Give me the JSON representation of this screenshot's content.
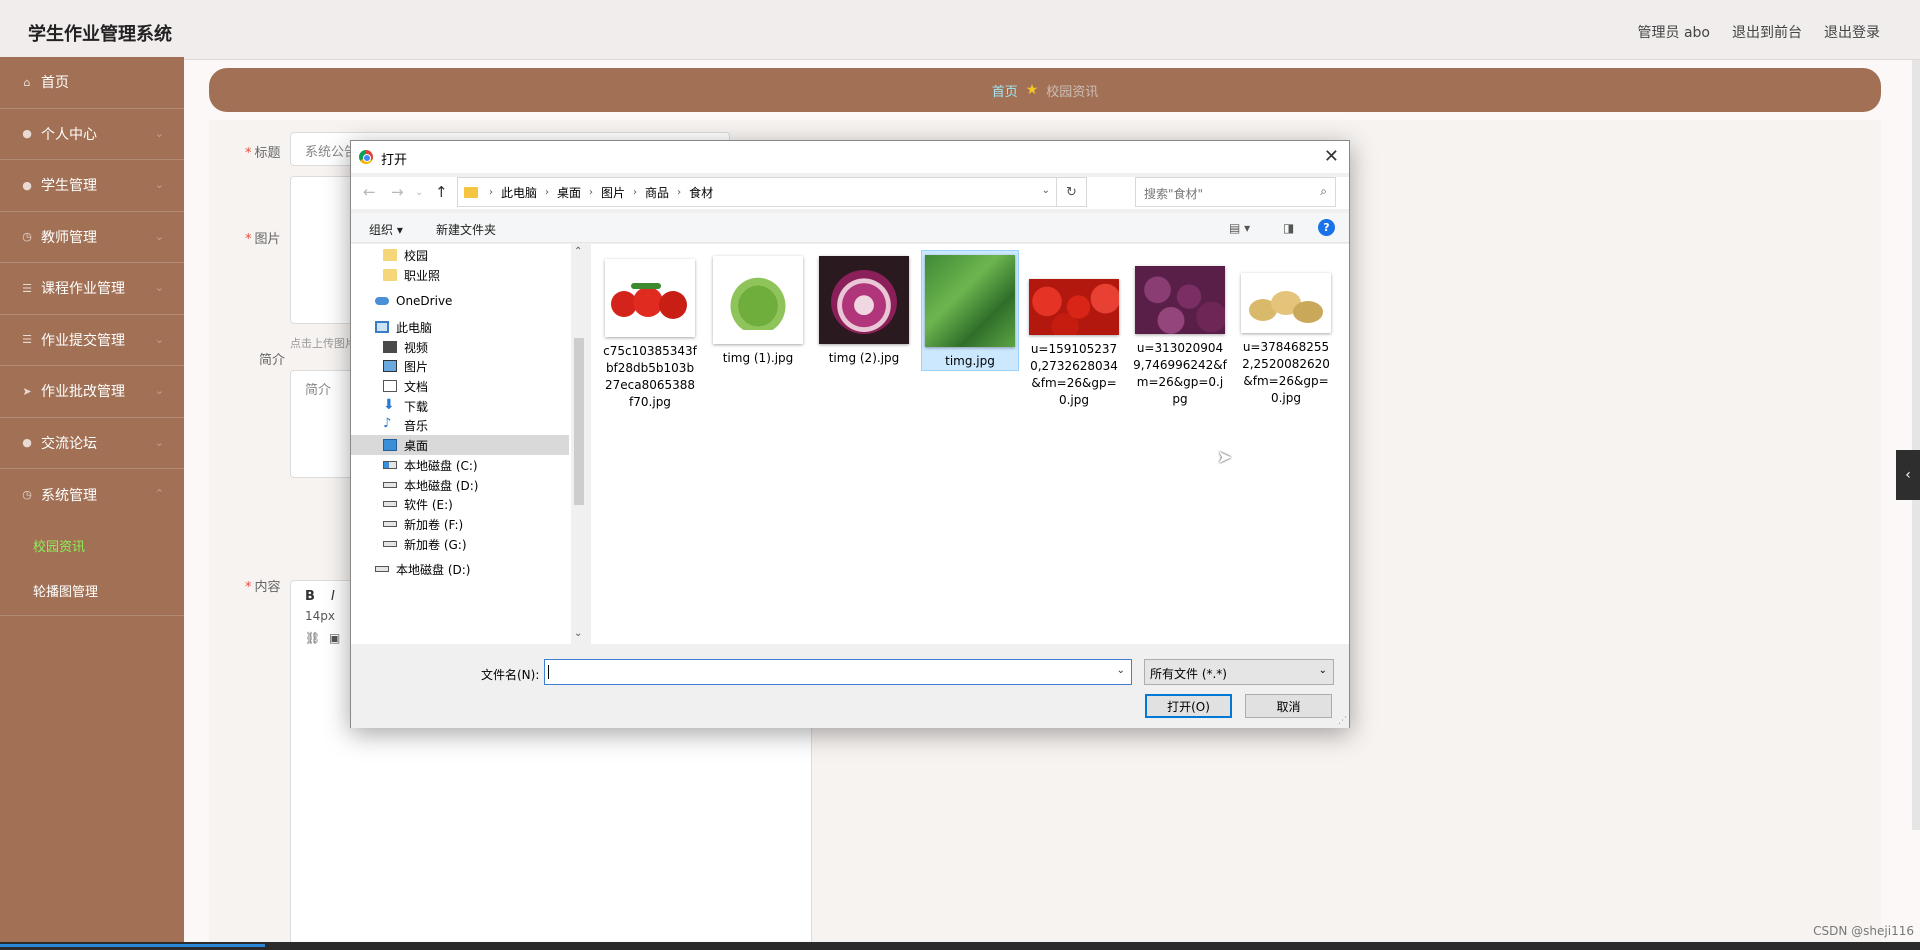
{
  "header": {
    "brand": "学生作业管理系统",
    "user": "管理员 abo",
    "to_front": "退出到前台",
    "logout": "退出登录"
  },
  "sidebar": {
    "items": [
      {
        "label": "首页",
        "icon": "home-icon"
      },
      {
        "label": "个人中心",
        "icon": "user-icon"
      },
      {
        "label": "学生管理",
        "icon": "user-icon"
      },
      {
        "label": "教师管理",
        "icon": "clock-icon"
      },
      {
        "label": "课程作业管理",
        "icon": "list-icon"
      },
      {
        "label": "作业提交管理",
        "icon": "list-icon"
      },
      {
        "label": "作业批改管理",
        "icon": "send-icon"
      },
      {
        "label": "交流论坛",
        "icon": "user-icon"
      },
      {
        "label": "系统管理",
        "icon": "clock-icon"
      }
    ],
    "submenu": [
      {
        "label": "校园资讯",
        "active": true
      },
      {
        "label": "轮播图管理",
        "active": false
      }
    ]
  },
  "breadcrumb": {
    "home": "首页",
    "current": "校园资讯"
  },
  "form": {
    "title_label": "标题",
    "title_value": "系统公告",
    "image_label": "图片",
    "upload_hint": "点击上传图片",
    "intro_label": "简介",
    "intro_placeholder": "简介",
    "content_label": "内容",
    "toolbar_bold": "B",
    "toolbar_italic": "I",
    "font_size": "14px"
  },
  "dialog": {
    "title": "打开",
    "path": [
      "此电脑",
      "桌面",
      "图片",
      "商品",
      "食材"
    ],
    "search_placeholder": "搜索\"食材\"",
    "organize": "组织 ▾",
    "new_folder": "新建文件夹",
    "help": "?",
    "nav_items": [
      {
        "label": "校园",
        "icon": "folder-icon"
      },
      {
        "label": "职业照",
        "icon": "folder-icon"
      },
      {
        "label": "OneDrive",
        "icon": "cloud-icon"
      },
      {
        "label": "此电脑",
        "icon": "computer-icon"
      },
      {
        "label": "视频",
        "icon": "video-icon"
      },
      {
        "label": "图片",
        "icon": "picture-icon"
      },
      {
        "label": "文档",
        "icon": "document-icon"
      },
      {
        "label": "下载",
        "icon": "download-icon"
      },
      {
        "label": "音乐",
        "icon": "music-icon"
      },
      {
        "label": "桌面",
        "icon": "desktop-icon"
      },
      {
        "label": "本地磁盘 (C:)",
        "icon": "drive-icon"
      },
      {
        "label": "本地磁盘 (D:)",
        "icon": "drive-icon"
      },
      {
        "label": "软件 (E:)",
        "icon": "drive-icon"
      },
      {
        "label": "新加卷 (F:)",
        "icon": "drive-icon"
      },
      {
        "label": "新加卷 (G:)",
        "icon": "drive-icon"
      },
      {
        "label": "本地磁盘 (D:)",
        "icon": "drive-icon"
      }
    ],
    "files": [
      {
        "name": "c75c10385343fbf28db5b103b27eca8065388f70.jpg",
        "thumb": "tomato"
      },
      {
        "name": "timg (1).jpg",
        "thumb": "arugula"
      },
      {
        "name": "timg (2).jpg",
        "thumb": "onion"
      },
      {
        "name": "timg.jpg",
        "thumb": "greens",
        "selected": true
      },
      {
        "name": "u=1591052370,2732628034&fm=26&gp=0.jpg",
        "thumb": "tomato-pile"
      },
      {
        "name": "u=3130209049,746996242&fm=26&gp=0.jpg",
        "thumb": "red-onions"
      },
      {
        "name": "u=3784682552,2520082620&fm=26&gp=0.jpg",
        "thumb": "potatoes"
      }
    ],
    "filename_label": "文件名(N):",
    "filename_value": "",
    "filetype": "所有文件 (*.*)",
    "open_button": "打开(O)",
    "cancel_button": "取消"
  },
  "watermark": "CSDN @sheji116"
}
